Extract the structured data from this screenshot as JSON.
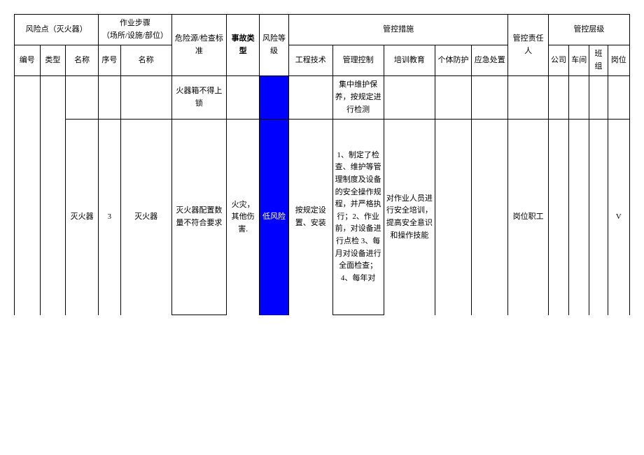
{
  "header": {
    "risk_point_group": "风险点（灭火器）",
    "work_step_group": "作业步骤\n（场所/设施/部位）",
    "hazard_source": "危险源/检查标准",
    "accident_type": "事故类型",
    "risk_level": "风险等级",
    "control_measures_group": "管控措施",
    "responsible_person": "管控责任人",
    "control_level_group": "管控层级",
    "sub": {
      "id": "编号",
      "type": "类型",
      "name": "名称",
      "seq": "序号",
      "step_name": "名称",
      "engineering": "工程技术",
      "management": "管理控制",
      "training": "培训教育",
      "ppe": "个体防护",
      "emergency": "应急处置",
      "company": "公司",
      "workshop": "车间",
      "team": "班组",
      "position": "岗位"
    }
  },
  "rows": [
    {
      "hazard": "火器箱不得上锁",
      "management": "集中维护保养，按规定进行检测"
    },
    {
      "name": "灭火器",
      "seq": "3",
      "step_name": "灭火器",
      "hazard": "灭火器配置数量不符合要求",
      "accident": "火灾，其他伤害.",
      "risk_level": "低风险",
      "engineering": "按规定设置、安装",
      "management": "1、制定了检查、维护等管理制度及设备的安全操作规程，并严格执行；2、作业前，对设备进行点检 3、每月对设备进行全面检查；4、每年对",
      "training": "对作业人员进行安全培训，提高安全意识和操作技能",
      "responsible": "岗位职工",
      "position_mark": "V"
    }
  ]
}
